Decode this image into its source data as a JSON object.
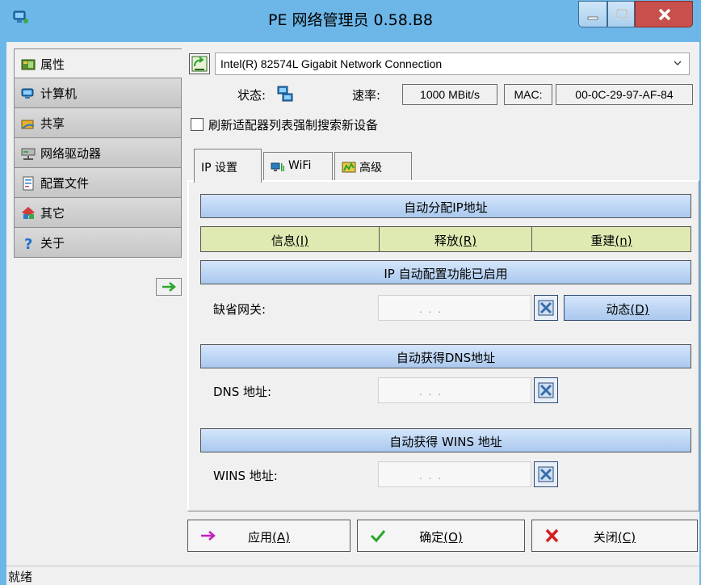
{
  "title": "PE 网络管理员 0.58.B8",
  "nav": [
    {
      "label": "属性",
      "icon": "properties-icon"
    },
    {
      "label": "计算机",
      "icon": "computer-icon"
    },
    {
      "label": "共享",
      "icon": "share-icon"
    },
    {
      "label": "网络驱动器",
      "icon": "network-drive-icon"
    },
    {
      "label": "配置文件",
      "icon": "config-file-icon"
    },
    {
      "label": "其它",
      "icon": "other-icon"
    },
    {
      "label": "关于",
      "icon": "help-icon"
    }
  ],
  "adapter": {
    "name": "Intel(R) 82574L Gigabit Network Connection"
  },
  "status": {
    "label": "状态:",
    "speed_label": "速率:",
    "speed": "1000 MBit/s",
    "mac_label": "MAC:",
    "mac": "00-0C-29-97-AF-84"
  },
  "refresh_checkbox": {
    "label": "刷新适配器列表强制搜索新设备"
  },
  "tabs": [
    {
      "label": "IP 设置"
    },
    {
      "label": "WiFi"
    },
    {
      "label": "高级"
    }
  ],
  "ip": {
    "auto_ip": "自动分配IP地址",
    "btn_info": "信息",
    "btn_info_key": "(I)",
    "btn_release": "释放",
    "btn_release_key": "(R)",
    "btn_renew": "重建",
    "btn_renew_key": "(n)",
    "autoconfig": "IP 自动配置功能已启用",
    "gateway_label": "缺省网关:",
    "gateway_value": ". . .",
    "dynamic_label": "动态",
    "dynamic_key": "(D)",
    "auto_dns": "自动获得DNS地址",
    "dns_label": "DNS 地址:",
    "dns_value": ". . .",
    "auto_wins": "自动获得 WINS 地址",
    "wins_label": "WINS 地址:",
    "wins_value": ". . ."
  },
  "buttons": {
    "apply": "应用",
    "apply_key": "(A)",
    "ok": "确定",
    "ok_key": "(O)",
    "close": "关闭",
    "close_key": "(C)"
  },
  "statusbar": "就绪",
  "colors": {
    "title_bg": "#6cb7e8",
    "blue_band": "#b7d1f3",
    "green_band": "#dfeab2",
    "close_btn": "#c7504c"
  }
}
